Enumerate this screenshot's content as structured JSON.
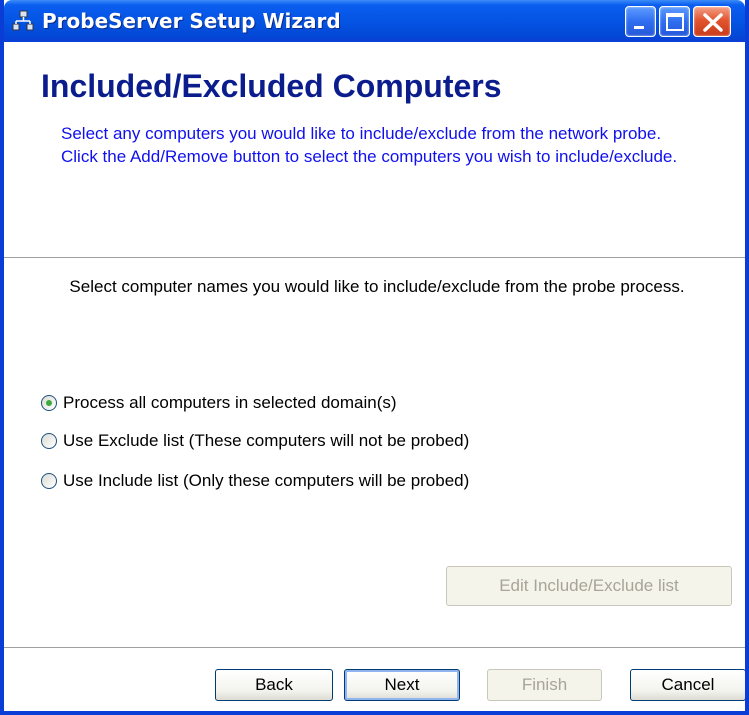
{
  "window": {
    "title": "ProbeServer Setup Wizard",
    "icon": "network-icon",
    "controls": [
      "minimize",
      "maximize",
      "close"
    ]
  },
  "header": {
    "title": "Included/Excluded Computers",
    "description": "Select any computers you would like to include/exclude from the network probe.  Click the Add/Remove button to select the computers you wish to include/exclude."
  },
  "main": {
    "instructions": "Select computer names you would like to include/exclude from the probe process.",
    "options": [
      {
        "label": "Process all computers in selected domain(s)",
        "selected": true
      },
      {
        "label": "Use Exclude list (These computers will not be probed)",
        "selected": false
      },
      {
        "label": "Use Include list (Only these computers will be probed)",
        "selected": false
      }
    ],
    "edit_button": "Edit Include/Exclude list"
  },
  "footer": {
    "back": "Back",
    "next": "Next",
    "finish": "Finish",
    "cancel": "Cancel"
  },
  "colors": {
    "title_color": "#0b1d8c",
    "description_color": "#1010ee",
    "titlebar": "#0554e3"
  }
}
